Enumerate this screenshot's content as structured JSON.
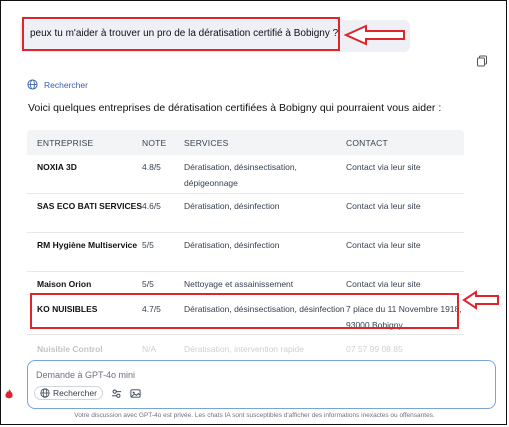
{
  "user_message": "peux tu m'aider à trouver un pro de la dératisation certifié à Bobigny ?",
  "search_label": "Rechercher",
  "intro_text": "Voici quelques entreprises de dératisation certifiées à Bobigny qui pourraient vous aider :",
  "table": {
    "headers": [
      "ENTREPRISE",
      "NOTE",
      "SERVICES",
      "CONTACT"
    ],
    "rows": [
      {
        "name": "NOXIA 3D",
        "note": "4.8/5",
        "services": "Dératisation, désinsectisation, dépigeonnage",
        "contact": "Contact via leur site"
      },
      {
        "name": "SAS ECO BATI SERVICES",
        "note": "4.6/5",
        "services": "Dératisation, désinfection",
        "contact": "Contact via leur site"
      },
      {
        "name": "RM Hygiène Multiservice",
        "note": "5/5",
        "services": "Dératisation, désinfection",
        "contact": "Contact via leur site"
      },
      {
        "name": "Maison Orion",
        "note": "5/5",
        "services": "Nettoyage et assainissement",
        "contact": "Contact via leur site"
      },
      {
        "name": "KO NUISIBLES",
        "note": "4.7/5",
        "services": "Dératisation, désinsectisation, désinfection",
        "contact": "7 place du 11 Novembre 1918, 93000 Bobigny"
      },
      {
        "name": "Nuisible Control",
        "note": "N/A",
        "services": "Dératisation, intervention rapide",
        "contact": "07 57 99 08 85"
      }
    ]
  },
  "input": {
    "placeholder": "Demande à GPT-4o mini",
    "search_button": "Rechercher"
  },
  "footer": "Votre discussion avec GPT-4o est privée. Les chats IA sont susceptibles d'afficher des informations inexactes ou offensantes.",
  "colors": {
    "highlight": "#e0242c",
    "accent": "#3b5ea8",
    "input_border": "#7aa4d8"
  }
}
